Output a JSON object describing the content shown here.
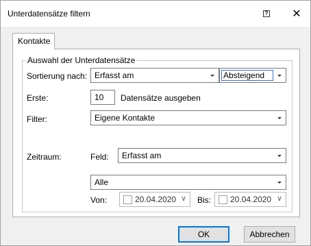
{
  "window": {
    "title": "Unterdatensätze filtern",
    "help_symbol": "?",
    "close_symbol": "✕"
  },
  "tabs": [
    {
      "label": "Kontakte",
      "selected": true
    }
  ],
  "group": {
    "legend": "Auswahl der Unterdatensätze"
  },
  "sort": {
    "label": "Sortierung nach:",
    "field_value": "Erfasst am",
    "order_value": "Absteigend"
  },
  "first": {
    "label": "Erste:",
    "value": "10",
    "suffix": "Datensätze ausgeben"
  },
  "filter": {
    "label": "Filter:",
    "value": "Eigene Kontakte"
  },
  "period": {
    "label": "Zeitraum:",
    "field_label": "Feld:",
    "field_value": "Erfasst am",
    "range_value": "Alle",
    "from_label": "Von:",
    "from_value": "20.04.2020",
    "to_label": "Bis:",
    "to_value": "20.04.2020",
    "chevron": "∨"
  },
  "buttons": {
    "ok": "OK",
    "cancel": "Abbrechen"
  }
}
